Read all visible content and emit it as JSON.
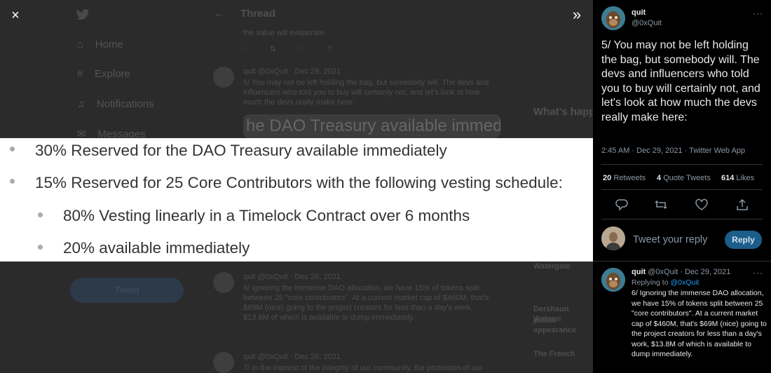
{
  "backdrop": {
    "nav": [
      "Home",
      "Explore",
      "Notifications",
      "Messages"
    ],
    "thread_title": "Thread",
    "prev_tweet_tail": "the value will evaporate.",
    "tweet5_header": "quit @0xQuit · Dec 29, 2021",
    "tweet5_text": "5/ You may not be left holding the bag, but somebody will.  The devs and influencers who told you to buy will certainly not, and let's look at how much the devs really make here:",
    "embed_preview": "he DAO Treasury available immed",
    "tweet6_header": "quit @0xQuit · Dec 29, 2021",
    "tweet6_text": "6/ Ignoring the immense DAO allocation, we have 15% of tokens split between 25 \"core contributors\". At a current market cap of $460M, that's $69M (nice) going to the project creators for less than a day's work. $13.8M of which is available to dump immediately.",
    "tweet7_header": "quit @0xQuit · Dec 29, 2021",
    "tweet7_text": "7/ In the interest of the integrity of our community, the protection of our",
    "tweet_button": "Tweet",
    "trends_title": "What's happening",
    "trend_items": [
      "Watergate",
      "Dershaun Watson",
      "public appearance",
      "The French"
    ]
  },
  "media": {
    "lines": [
      "30% Reserved for the DAO Treasury available immediately",
      "15% Reserved for 25 Core Contributors with the following vesting schedule:",
      "80% Vesting linearly in a Timelock Contract over 6 months",
      "20% available immediately"
    ]
  },
  "controls": {
    "close_icon": "×",
    "expand_icon": "»"
  },
  "sidebar": {
    "name": "quit",
    "handle": "@0xQuit",
    "more": "···",
    "tweet_text": "5/ You may not be left holding the bag, but somebody will. The devs and influencers who told you to buy will certainly not, and let's look at how much the devs really make here:",
    "meta": "2:45 AM · Dec 29, 2021 · Twitter Web App",
    "stats": {
      "retweets_count": "20",
      "retweets_label": "Retweets",
      "quotes_count": "4",
      "quotes_label": "Quote Tweets",
      "likes_count": "614",
      "likes_label": "Likes"
    },
    "reply_placeholder": "Tweet your reply",
    "reply_button": "Reply",
    "next": {
      "name": "quit",
      "handle_date": "@0xQuit · Dec 29, 2021",
      "replying_to_label": "Replying to",
      "replying_to_handle": "@0xQuit",
      "text": "6/ Ignoring the immense DAO allocation, we have 15% of tokens split between 25 \"core contributors\". At a current market cap of $460M, that's $69M (nice) going to the project creators for less than a day's work, $13.8M of which is available to dump immediately."
    }
  },
  "colors": {
    "accent": "#1d9bf0",
    "reply_button": "#1d5d8b",
    "panel_bg": "#000000",
    "overlay_bg": "#2b2b2b"
  }
}
